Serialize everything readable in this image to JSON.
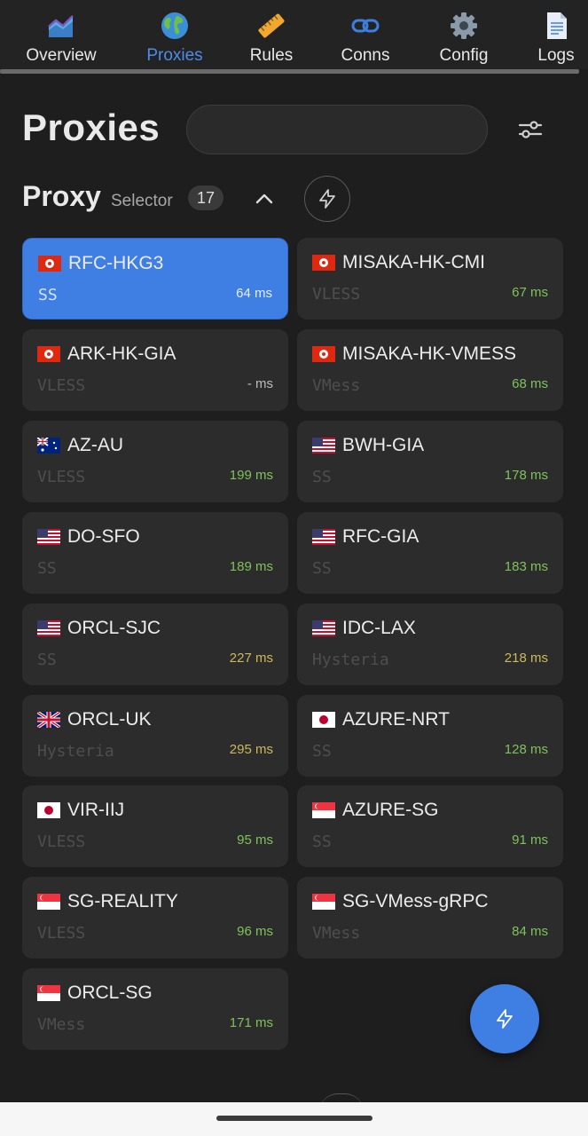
{
  "nav": {
    "items": [
      {
        "label": "Overview",
        "icon": "area-chart-icon",
        "active": false
      },
      {
        "label": "Proxies",
        "icon": "globe-icon",
        "active": true
      },
      {
        "label": "Rules",
        "icon": "ruler-icon",
        "active": false
      },
      {
        "label": "Conns",
        "icon": "link-icon",
        "active": false
      },
      {
        "label": "Config",
        "icon": "gear-icon",
        "active": false
      },
      {
        "label": "Logs",
        "icon": "document-icon",
        "active": false
      }
    ]
  },
  "header": {
    "title": "Proxies",
    "search_value": "",
    "filter_icon": "sliders-icon"
  },
  "group": {
    "name": "Proxy",
    "type": "Selector",
    "count": "17",
    "collapse_icon": "chevron-up-icon",
    "test_icon": "lightning-icon"
  },
  "proxies": [
    {
      "flag": "HK",
      "name": "RFC-HKG3",
      "type": "SS",
      "delay": "64 ms",
      "selected": true
    },
    {
      "flag": "HK",
      "name": "MISAKA-HK-CMI",
      "type": "VLESS",
      "delay": "67 ms",
      "selected": false
    },
    {
      "flag": "HK",
      "name": "ARK-HK-GIA",
      "type": "VLESS",
      "delay": "- ms",
      "selected": false
    },
    {
      "flag": "HK",
      "name": "MISAKA-HK-VMESS",
      "type": "VMess",
      "delay": "68 ms",
      "selected": false
    },
    {
      "flag": "AU",
      "name": "AZ-AU",
      "type": "VLESS",
      "delay": "199 ms",
      "selected": false
    },
    {
      "flag": "US",
      "name": "BWH-GIA",
      "type": "SS",
      "delay": "178 ms",
      "selected": false
    },
    {
      "flag": "US",
      "name": "DO-SFO",
      "type": "SS",
      "delay": "189 ms",
      "selected": false
    },
    {
      "flag": "US",
      "name": "RFC-GIA",
      "type": "SS",
      "delay": "183 ms",
      "selected": false
    },
    {
      "flag": "US",
      "name": "ORCL-SJC",
      "type": "SS",
      "delay": "227 ms",
      "selected": false
    },
    {
      "flag": "US",
      "name": "IDC-LAX",
      "type": "Hysteria",
      "delay": "218 ms",
      "selected": false
    },
    {
      "flag": "GB",
      "name": "ORCL-UK",
      "type": "Hysteria",
      "delay": "295 ms",
      "selected": false
    },
    {
      "flag": "JP",
      "name": "AZURE-NRT",
      "type": "SS",
      "delay": "128 ms",
      "selected": false
    },
    {
      "flag": "JP",
      "name": "VIR-IIJ",
      "type": "VLESS",
      "delay": "95 ms",
      "selected": false
    },
    {
      "flag": "SG",
      "name": "AZURE-SG",
      "type": "SS",
      "delay": "91 ms",
      "selected": false
    },
    {
      "flag": "SG",
      "name": "SG-REALITY",
      "type": "VLESS",
      "delay": "96 ms",
      "selected": false
    },
    {
      "flag": "SG",
      "name": "SG-VMess-gRPC",
      "type": "VMess",
      "delay": "84 ms",
      "selected": false
    },
    {
      "flag": "SG",
      "name": "ORCL-SG",
      "type": "VMess",
      "delay": "171 ms",
      "selected": false
    }
  ],
  "fab": {
    "icon": "lightning-icon"
  },
  "colors": {
    "accent": "#3f7fe3",
    "delay_good": "#7ec35a",
    "delay_medium": "#cdb85a",
    "delay_none": "#bbbbbb"
  }
}
